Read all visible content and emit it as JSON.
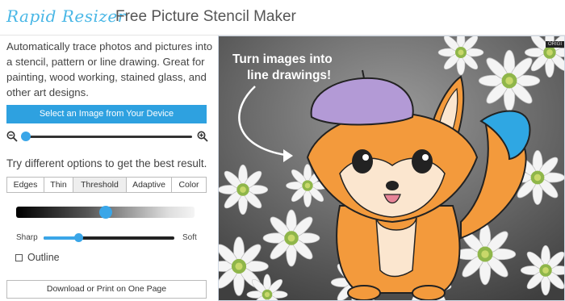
{
  "header": {
    "logo_text": "Rapid Resizer",
    "title": "Free Picture Stencil Maker"
  },
  "sidebar": {
    "description": "Automatically trace photos and pictures into a stencil, pattern or line drawing. Great for painting, wood working, stained glass, and other art designs.",
    "select_button": "Select an Image from Your Device",
    "zoom_out_icon": "zoom-out-icon",
    "zoom_in_icon": "zoom-in-icon",
    "try_text": "Try different options to get the best result.",
    "tabs": [
      {
        "label": "Edges",
        "active": false
      },
      {
        "label": "Thin",
        "active": false
      },
      {
        "label": "Threshold",
        "active": true
      },
      {
        "label": "Adaptive",
        "active": false
      },
      {
        "label": "Color",
        "active": false
      }
    ],
    "sharp_label": "Sharp",
    "soft_label": "Soft",
    "outline_label": "Outline",
    "outline_checked": false,
    "download_button": "Download or Print on One Page"
  },
  "preview": {
    "badge": "ORIGI",
    "caption_line1": "Turn images into",
    "caption_line2": "line drawings!"
  },
  "colors": {
    "accent": "#2ea1e0",
    "fox_orange": "#f39a3c",
    "beret_purple": "#b39ad6",
    "tail_blue": "#2fa7e3"
  }
}
